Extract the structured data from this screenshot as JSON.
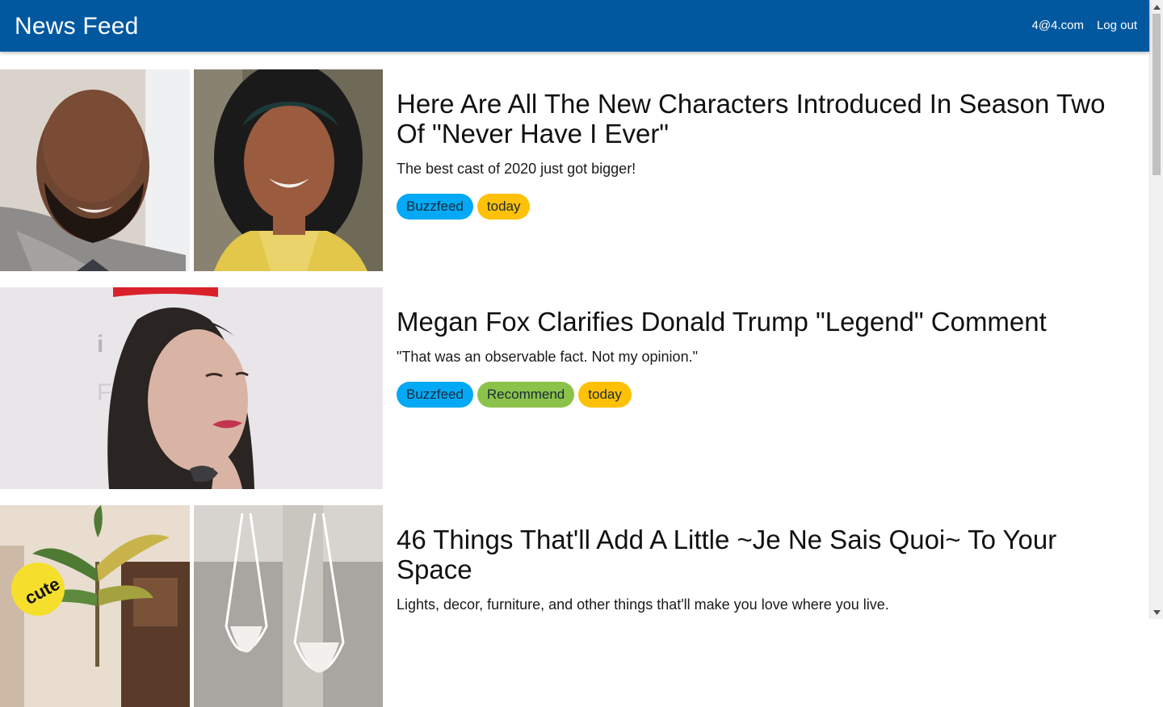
{
  "app": {
    "title": "News Feed",
    "user_email": "4@4.com",
    "logout_label": "Log out"
  },
  "colors": {
    "header": "#01589f",
    "source_tag": "#03a9f4",
    "recommend_tag": "#8bc34a",
    "date_tag": "#ffc107"
  },
  "articles": [
    {
      "title": "Here Are All The New Characters Introduced In Season Two Of \"Never Have I Ever\"",
      "description": "The best cast of 2020 just got bigger!",
      "tags": [
        "Buzzfeed",
        "today"
      ],
      "image": "two-actor-portraits"
    },
    {
      "title": "Megan Fox Clarifies Donald Trump \"Legend\" Comment",
      "description": "\"That was an observable fact. Not my opinion.\"",
      "tags": [
        "Buzzfeed",
        "Recommend",
        "today"
      ],
      "image": "celebrity-portrait"
    },
    {
      "title": "46 Things That'll Add A Little ~Je Ne Sais Quoi~ To Your Space",
      "description": "Lights, decor, furniture, and other things that'll make you love where you live.",
      "tags": [],
      "image": "home-decor-collage",
      "badge": "cute"
    }
  ]
}
